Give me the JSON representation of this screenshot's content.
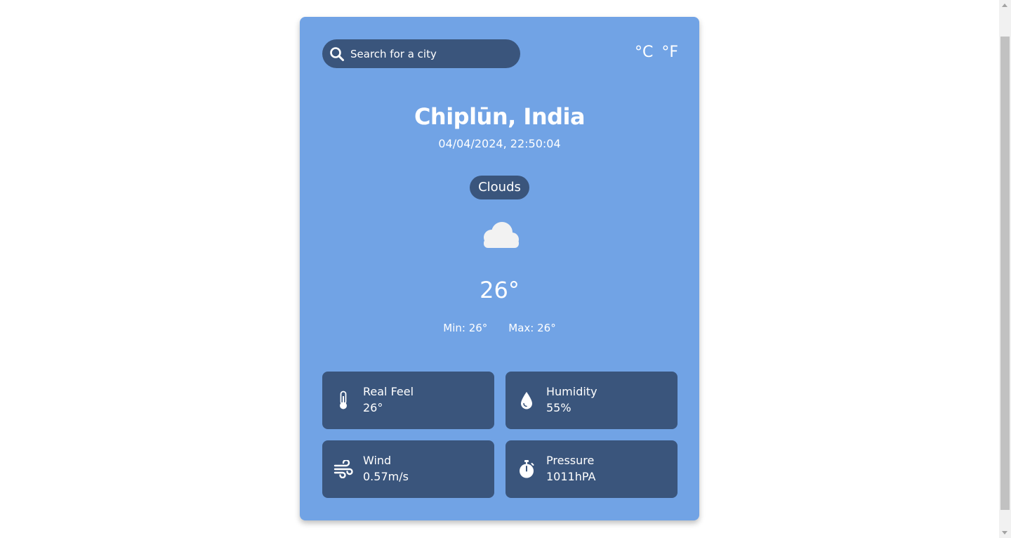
{
  "search": {
    "placeholder": "Search for a city",
    "icon": "search-icon"
  },
  "units": {
    "celsius": "°C",
    "fahrenheit": "°F"
  },
  "location": {
    "city": "Chiplūn, India",
    "datetime": "04/04/2024, 22:50:04"
  },
  "weather": {
    "condition": "Clouds",
    "icon": "cloud-icon",
    "temperature": "26°",
    "min": "Min: 26°",
    "max": "Max: 26°"
  },
  "details": [
    {
      "label": "Real Feel",
      "value": "26°",
      "icon": "thermometer-icon"
    },
    {
      "label": "Humidity",
      "value": "55%",
      "icon": "water-drop-icon"
    },
    {
      "label": "Wind",
      "value": "0.57m/s",
      "icon": "wind-icon"
    },
    {
      "label": "Pressure",
      "value": "1011hPA",
      "icon": "stopwatch-icon"
    }
  ],
  "colors": {
    "card_background": "#71a3e5",
    "panel_background": "#3a557c",
    "text": "#ffffff",
    "cloud": "#f2f2f2"
  }
}
